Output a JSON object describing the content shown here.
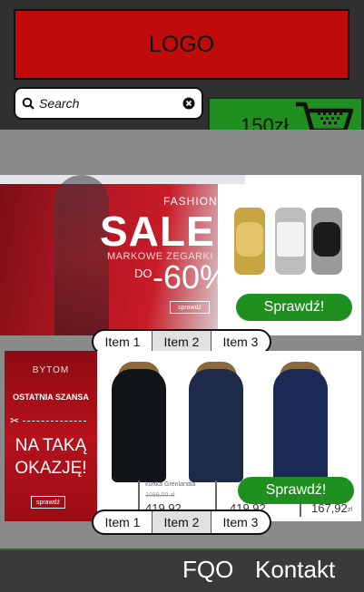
{
  "header": {
    "logo_text": "LOGO",
    "search_placeholder": "Search",
    "cart_total": "150zł"
  },
  "banner1": {
    "fashion": "FASHION",
    "sale": "SALE",
    "subtitle": "MARKOWE ZEGARKI",
    "do": "DO",
    "discount": "-60%",
    "small_cta": "sprawdź",
    "cta": "Sprawdź!",
    "pager": [
      "Item 1",
      "Item 2",
      "Item 3"
    ],
    "active_item": "Item 2"
  },
  "banner2": {
    "brand": "BYTOM",
    "tagline": "OSTATNIA SZANSA",
    "headline_line1": "NA TAKĄ",
    "headline_line2": "OKAZJĘ!",
    "small_cta": "sprawdź",
    "product_name": "kurtka Grenlandia",
    "old_price": "1099,00 zł",
    "new_price_1": "419,92",
    "new_price_2": "419,92",
    "new_price_3": "167,92",
    "price_unit": "zł",
    "cta": "Sprawdź!",
    "pager": [
      "Item 1",
      "Item 2",
      "Item 3"
    ],
    "active_item": "Item 2"
  },
  "footer": {
    "faq": "FQO",
    "contact": "Kontakt"
  },
  "colors": {
    "logo_bg": "#c00b0b",
    "cart_bg": "#1f8f1f",
    "cta_bg": "#1f8f1f",
    "page_bg": "#2e2e2e",
    "content_bg": "#8a8a8a"
  },
  "icons": {
    "search": "search-icon",
    "clear": "clear-icon",
    "cart": "cart-icon"
  }
}
